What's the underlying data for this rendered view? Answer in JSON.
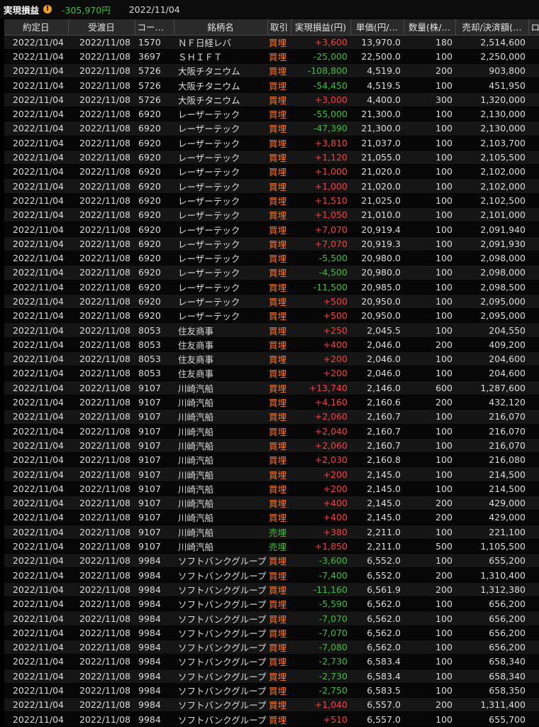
{
  "header": {
    "title": "実現損益",
    "warn_glyph": "!",
    "total": "-305,970円",
    "date": "2022/11/04"
  },
  "columns": [
    "約定日",
    "受渡日",
    "コード/…",
    "銘柄名",
    "取引",
    "実現損益(円)",
    "単価(円/…",
    "数量(株/…",
    "売却/決済額(…",
    "ロ"
  ],
  "colors": {
    "buy": "#ff7a2a",
    "sell": "#3fbf3f",
    "profit": "#ff4040",
    "loss": "#3fbf3f"
  },
  "rows": [
    [
      "2022/11/04",
      "2022/11/08",
      "1570",
      "ＮＦ日経レバ",
      "買埋",
      "+3,600",
      "13,970.0",
      "180",
      "2,514,600"
    ],
    [
      "2022/11/04",
      "2022/11/08",
      "3697",
      "ＳＨＩＦＴ",
      "買埋",
      "-25,000",
      "22,500.0",
      "100",
      "2,250,000"
    ],
    [
      "2022/11/04",
      "2022/11/08",
      "5726",
      "大阪チタニウム",
      "買埋",
      "-108,800",
      "4,519.0",
      "200",
      "903,800"
    ],
    [
      "2022/11/04",
      "2022/11/08",
      "5726",
      "大阪チタニウム",
      "買埋",
      "-54,450",
      "4,519.5",
      "100",
      "451,950"
    ],
    [
      "2022/11/04",
      "2022/11/08",
      "5726",
      "大阪チタニウム",
      "買埋",
      "+3,000",
      "4,400.0",
      "300",
      "1,320,000"
    ],
    [
      "2022/11/04",
      "2022/11/08",
      "6920",
      "レーザーテック",
      "買埋",
      "-55,000",
      "21,300.0",
      "100",
      "2,130,000"
    ],
    [
      "2022/11/04",
      "2022/11/08",
      "6920",
      "レーザーテック",
      "買埋",
      "-47,390",
      "21,300.0",
      "100",
      "2,130,000"
    ],
    [
      "2022/11/04",
      "2022/11/08",
      "6920",
      "レーザーテック",
      "買埋",
      "+3,810",
      "21,037.0",
      "100",
      "2,103,700"
    ],
    [
      "2022/11/04",
      "2022/11/08",
      "6920",
      "レーザーテック",
      "買埋",
      "+1,120",
      "21,055.0",
      "100",
      "2,105,500"
    ],
    [
      "2022/11/04",
      "2022/11/08",
      "6920",
      "レーザーテック",
      "買埋",
      "+1,000",
      "21,020.0",
      "100",
      "2,102,000"
    ],
    [
      "2022/11/04",
      "2022/11/08",
      "6920",
      "レーザーテック",
      "買埋",
      "+1,000",
      "21,020.0",
      "100",
      "2,102,000"
    ],
    [
      "2022/11/04",
      "2022/11/08",
      "6920",
      "レーザーテック",
      "買埋",
      "+1,510",
      "21,025.0",
      "100",
      "2,102,500"
    ],
    [
      "2022/11/04",
      "2022/11/08",
      "6920",
      "レーザーテック",
      "買埋",
      "+1,050",
      "21,010.0",
      "100",
      "2,101,000"
    ],
    [
      "2022/11/04",
      "2022/11/08",
      "6920",
      "レーザーテック",
      "買埋",
      "+7,070",
      "20,919.4",
      "100",
      "2,091,940"
    ],
    [
      "2022/11/04",
      "2022/11/08",
      "6920",
      "レーザーテック",
      "買埋",
      "+7,070",
      "20,919.3",
      "100",
      "2,091,930"
    ],
    [
      "2022/11/04",
      "2022/11/08",
      "6920",
      "レーザーテック",
      "買埋",
      "-5,500",
      "20,980.0",
      "100",
      "2,098,000"
    ],
    [
      "2022/11/04",
      "2022/11/08",
      "6920",
      "レーザーテック",
      "買埋",
      "-4,500",
      "20,980.0",
      "100",
      "2,098,000"
    ],
    [
      "2022/11/04",
      "2022/11/08",
      "6920",
      "レーザーテック",
      "買埋",
      "-11,500",
      "20,985.0",
      "100",
      "2,098,500"
    ],
    [
      "2022/11/04",
      "2022/11/08",
      "6920",
      "レーザーテック",
      "買埋",
      "+500",
      "20,950.0",
      "100",
      "2,095,000"
    ],
    [
      "2022/11/04",
      "2022/11/08",
      "6920",
      "レーザーテック",
      "買埋",
      "+500",
      "20,950.0",
      "100",
      "2,095,000"
    ],
    [
      "2022/11/04",
      "2022/11/08",
      "8053",
      "住友商事",
      "買埋",
      "+250",
      "2,045.5",
      "100",
      "204,550"
    ],
    [
      "2022/11/04",
      "2022/11/08",
      "8053",
      "住友商事",
      "買埋",
      "+400",
      "2,046.0",
      "200",
      "409,200"
    ],
    [
      "2022/11/04",
      "2022/11/08",
      "8053",
      "住友商事",
      "買埋",
      "+200",
      "2,046.0",
      "100",
      "204,600"
    ],
    [
      "2022/11/04",
      "2022/11/08",
      "8053",
      "住友商事",
      "買埋",
      "+200",
      "2,046.0",
      "100",
      "204,600"
    ],
    [
      "2022/11/04",
      "2022/11/08",
      "9107",
      "川崎汽船",
      "買埋",
      "+13,740",
      "2,146.0",
      "600",
      "1,287,600"
    ],
    [
      "2022/11/04",
      "2022/11/08",
      "9107",
      "川崎汽船",
      "買埋",
      "+4,160",
      "2,160.6",
      "200",
      "432,120"
    ],
    [
      "2022/11/04",
      "2022/11/08",
      "9107",
      "川崎汽船",
      "買埋",
      "+2,060",
      "2,160.7",
      "100",
      "216,070"
    ],
    [
      "2022/11/04",
      "2022/11/08",
      "9107",
      "川崎汽船",
      "買埋",
      "+2,040",
      "2,160.7",
      "100",
      "216,070"
    ],
    [
      "2022/11/04",
      "2022/11/08",
      "9107",
      "川崎汽船",
      "買埋",
      "+2,060",
      "2,160.7",
      "100",
      "216,070"
    ],
    [
      "2022/11/04",
      "2022/11/08",
      "9107",
      "川崎汽船",
      "買埋",
      "+2,030",
      "2,160.8",
      "100",
      "216,080"
    ],
    [
      "2022/11/04",
      "2022/11/08",
      "9107",
      "川崎汽船",
      "買埋",
      "+200",
      "2,145.0",
      "100",
      "214,500"
    ],
    [
      "2022/11/04",
      "2022/11/08",
      "9107",
      "川崎汽船",
      "買埋",
      "+200",
      "2,145.0",
      "100",
      "214,500"
    ],
    [
      "2022/11/04",
      "2022/11/08",
      "9107",
      "川崎汽船",
      "買埋",
      "+400",
      "2,145.0",
      "200",
      "429,000"
    ],
    [
      "2022/11/04",
      "2022/11/08",
      "9107",
      "川崎汽船",
      "買埋",
      "+400",
      "2,145.0",
      "200",
      "429,000"
    ],
    [
      "2022/11/04",
      "2022/11/08",
      "9107",
      "川崎汽船",
      "売埋",
      "+380",
      "2,211.0",
      "100",
      "221,100"
    ],
    [
      "2022/11/04",
      "2022/11/08",
      "9107",
      "川崎汽船",
      "売埋",
      "+1,850",
      "2,211.0",
      "500",
      "1,105,500"
    ],
    [
      "2022/11/04",
      "2022/11/08",
      "9984",
      "ソフトバンクグループ",
      "買埋",
      "-3,600",
      "6,552.0",
      "100",
      "655,200"
    ],
    [
      "2022/11/04",
      "2022/11/08",
      "9984",
      "ソフトバンクグループ",
      "買埋",
      "-7,400",
      "6,552.0",
      "200",
      "1,310,400"
    ],
    [
      "2022/11/04",
      "2022/11/08",
      "9984",
      "ソフトバンクグループ",
      "買埋",
      "-11,160",
      "6,561.9",
      "200",
      "1,312,380"
    ],
    [
      "2022/11/04",
      "2022/11/08",
      "9984",
      "ソフトバンクグループ",
      "買埋",
      "-5,590",
      "6,562.0",
      "100",
      "656,200"
    ],
    [
      "2022/11/04",
      "2022/11/08",
      "9984",
      "ソフトバンクグループ",
      "買埋",
      "-7,070",
      "6,562.0",
      "100",
      "656,200"
    ],
    [
      "2022/11/04",
      "2022/11/08",
      "9984",
      "ソフトバンクグループ",
      "買埋",
      "-7,070",
      "6,562.0",
      "100",
      "656,200"
    ],
    [
      "2022/11/04",
      "2022/11/08",
      "9984",
      "ソフトバンクグループ",
      "買埋",
      "-7,080",
      "6,562.0",
      "100",
      "656,200"
    ],
    [
      "2022/11/04",
      "2022/11/08",
      "9984",
      "ソフトバンクグループ",
      "買埋",
      "-2,730",
      "6,583.4",
      "100",
      "658,340"
    ],
    [
      "2022/11/04",
      "2022/11/08",
      "9984",
      "ソフトバンクグループ",
      "買埋",
      "-2,730",
      "6,583.4",
      "100",
      "658,340"
    ],
    [
      "2022/11/04",
      "2022/11/08",
      "9984",
      "ソフトバンクグループ",
      "買埋",
      "-2,750",
      "6,583.5",
      "100",
      "658,350"
    ],
    [
      "2022/11/04",
      "2022/11/08",
      "9984",
      "ソフトバンクグループ",
      "買埋",
      "+1,040",
      "6,557.0",
      "200",
      "1,311,400"
    ],
    [
      "2022/11/04",
      "2022/11/08",
      "9984",
      "ソフトバンクグループ",
      "買埋",
      "+510",
      "6,557.0",
      "100",
      "655,700"
    ]
  ]
}
